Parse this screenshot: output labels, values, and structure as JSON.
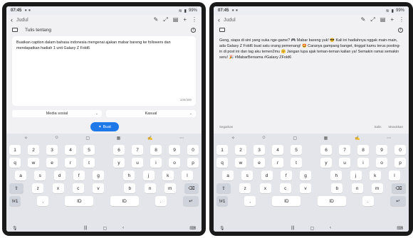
{
  "left": {
    "status": {
      "time": "07:45",
      "battery": "99%"
    },
    "appbar": {
      "title": "Judul"
    },
    "subbar": {
      "title": "Tulis tentang"
    },
    "prompt_text": "Buatkan caption dalam bahasa indonesia mengenai ajakan mabar bareng ke followers dan mendapatkan hadiah 1 unit Galaxy Z Fold6",
    "counter": "100/300",
    "select_platform": "Media sosial",
    "select_tone": "Kasual",
    "generate_label": "Buat"
  },
  "right": {
    "status": {
      "time": "07:45",
      "battery": "99%"
    },
    "appbar": {
      "title": "Judul"
    },
    "result_text": "Geng, siapa di sini yang suka nge-game? 🎮 Mabar bareng yuk! 😎 Kali ini hadiahnya nggak main-main, ada Galaxy Z Fold6 buat satu orang pemenang! 🤩 Caranya gampang banget, tinggal kamu terus posting-in di post ini dan tag aku temen2mu 🤗 Jangan lupa ajak teman-teman kalian ya! Semakin ramai semakin seru! 🎉 #MabarBersama #Galaxy ZFold6",
    "action_regenerate": "Segarkan",
    "action_copy": "Salin",
    "action_insert": "Masukkan"
  },
  "keyboard": {
    "numbers": [
      "1",
      "2",
      "3",
      "4",
      "5",
      "6",
      "7",
      "8",
      "9",
      "0"
    ],
    "row1": [
      "q",
      "w",
      "e",
      "r",
      "t",
      "y",
      "u",
      "i",
      "o",
      "p"
    ],
    "row2": [
      "a",
      "s",
      "d",
      "f",
      "g",
      "h",
      "j",
      "k",
      "l"
    ],
    "row3": [
      "z",
      "x",
      "c",
      "v",
      "b",
      "n",
      "m"
    ],
    "sym": "!#1",
    "comma": ",",
    "space_left": "ID",
    "space_right": "ID",
    "period": "."
  }
}
